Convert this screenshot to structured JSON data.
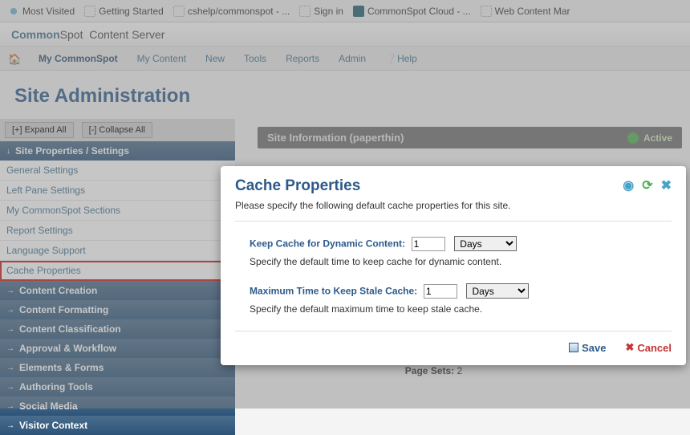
{
  "bookmarks": [
    {
      "label": "Most Visited"
    },
    {
      "label": "Getting Started"
    },
    {
      "label": "cshelp/commonspot - ..."
    },
    {
      "label": "Sign in"
    },
    {
      "label": "CommonSpot Cloud - ..."
    },
    {
      "label": "Web Content Mar"
    }
  ],
  "header": {
    "brand1": "Common",
    "brand2": "Spot",
    "suffix": "Content Server"
  },
  "menu": {
    "mycs": "My CommonSpot",
    "mycontent": "My Content",
    "new": "New",
    "tools": "Tools",
    "reports": "Reports",
    "admin": "Admin",
    "help": "Help"
  },
  "page_title": "Site Administration",
  "tree": {
    "expand": "[+] Expand All",
    "collapse": "[-] Collapse All"
  },
  "nav": {
    "h1": "Site Properties / Settings",
    "items1": [
      "General Settings",
      "Left Pane Settings",
      "My CommonSpot Sections",
      "Report Settings",
      "Language Support",
      "Cache Properties"
    ],
    "headers2": [
      "Content Creation",
      "Content Formatting",
      "Content Classification",
      "Approval & Workflow",
      "Elements & Forms",
      "Authoring Tools",
      "Social Media",
      "Visitor Context"
    ]
  },
  "panel": {
    "title": "Site Information (paperthin)",
    "status": "Active",
    "pagesets_label": "Page Sets:",
    "pagesets_val": "2"
  },
  "dialog": {
    "title": "Cache Properties",
    "subtitle": "Please specify the following default cache properties for this site.",
    "f1_label": "Keep Cache for Dynamic Content:",
    "f1_val": "1",
    "f1_unit": "Days",
    "f1_desc": "Specify the default time to keep cache for dynamic content.",
    "f2_label": "Maximum Time to Keep Stale Cache:",
    "f2_val": "1",
    "f2_unit": "Days",
    "f2_desc": "Specify the default maximum time to keep stale cache.",
    "save": "Save",
    "cancel": "Cancel"
  }
}
